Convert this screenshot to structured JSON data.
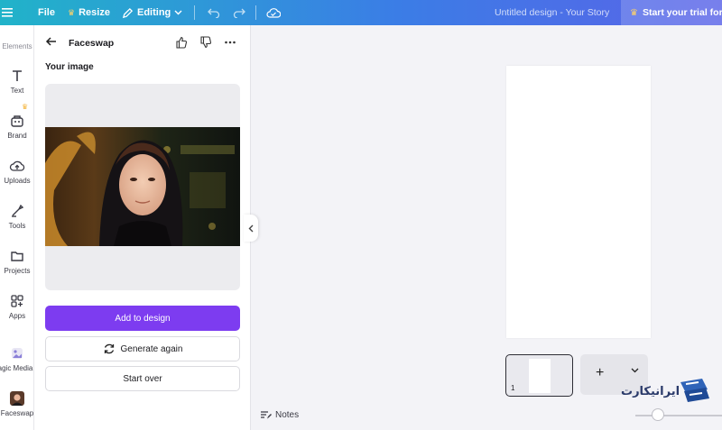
{
  "topbar": {
    "file_label": "File",
    "resize_label": "Resize",
    "editing_label": "Editing",
    "design_title": "Untitled design - Your Story",
    "trial_label": "Start your trial for €"
  },
  "rail": {
    "items": [
      {
        "label": "Elements",
        "icon": "elements-icon"
      },
      {
        "label": "Text",
        "icon": "text-icon"
      },
      {
        "label": "Brand",
        "icon": "brand-icon"
      },
      {
        "label": "Uploads",
        "icon": "uploads-icon"
      },
      {
        "label": "Tools",
        "icon": "tools-icon"
      },
      {
        "label": "Projects",
        "icon": "projects-icon"
      },
      {
        "label": "Apps",
        "icon": "apps-icon"
      },
      {
        "label": "agic Media",
        "icon": "magic-media-icon"
      },
      {
        "label": "Faceswap",
        "icon": "faceswap-icon"
      }
    ]
  },
  "panel": {
    "title": "Faceswap",
    "section_label": "Your image",
    "add_to_design_label": "Add to design",
    "generate_again_label": "Generate again",
    "start_over_label": "Start over"
  },
  "canvas": {
    "page_number": "1",
    "notes_label": "Notes"
  },
  "watermark": {
    "text": "ایرانیکارت"
  },
  "colors": {
    "accent": "#7d3cf0",
    "topbar_start": "#21b3c9",
    "topbar_end": "#5a63e8",
    "crown": "#f4b43a"
  }
}
